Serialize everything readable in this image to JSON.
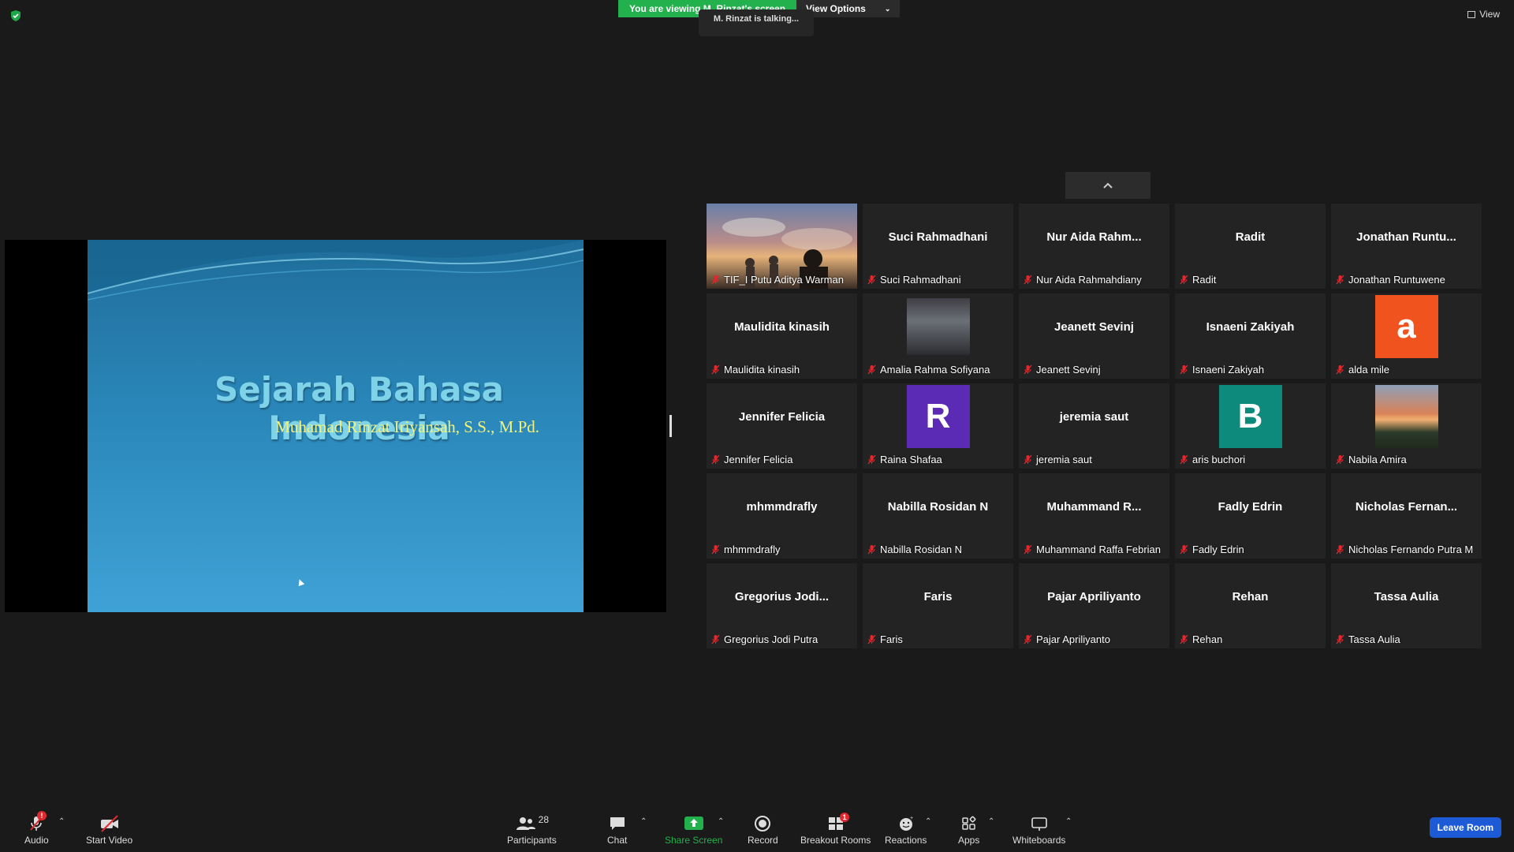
{
  "banner": {
    "viewing_text": "You are viewing M. Rinzat's screen",
    "view_options_label": "View Options",
    "talking_text": "M. Rinzat is talking..."
  },
  "view_button": {
    "label": "View"
  },
  "slide": {
    "title": "Sejarah Bahasa Indonesia",
    "author": "Muhamad Rinzat Iriyansah, S.S., M.Pd."
  },
  "participants_tiles": [
    {
      "center": "",
      "name": "TIF_I Putu Aditya Warman",
      "media": "photo-sky"
    },
    {
      "center": "Suci Rahmadhani",
      "name": "Suci Rahmadhani"
    },
    {
      "center": "Nur Aida Rahm...",
      "name": "Nur Aida Rahmahdiany"
    },
    {
      "center": "Radit",
      "name": "Radit"
    },
    {
      "center": "Jonathan  Runtu...",
      "name": "Jonathan Runtuwene"
    },
    {
      "center": "Maulidita kinasih",
      "name": "Maulidita kinasih"
    },
    {
      "center": "",
      "name": "Amalia Rahma Sofiyana",
      "media": "photo-dark"
    },
    {
      "center": "Jeanett Sevinj",
      "name": "Jeanett Sevinj"
    },
    {
      "center": "Isnaeni Zakiyah",
      "name": "Isnaeni Zakiyah"
    },
    {
      "center": "",
      "name": "alda mile",
      "avatar_letter": "a",
      "avatar_color": "#f0531e"
    },
    {
      "center": "Jennifer Felicia",
      "name": "Jennifer Felicia"
    },
    {
      "center": "",
      "name": "Raina Shafaa",
      "avatar_letter": "R",
      "avatar_color": "#5b2bb5"
    },
    {
      "center": "jeremia saut",
      "name": "jeremia saut"
    },
    {
      "center": "",
      "name": "aris buchori",
      "avatar_letter": "B",
      "avatar_color": "#0d8a7c"
    },
    {
      "center": "",
      "name": "Nabila Amira",
      "media": "photo-sunset"
    },
    {
      "center": "mhmmdrafly",
      "name": "mhmmdrafly"
    },
    {
      "center": "Nabilla Rosidan N",
      "name": "Nabilla Rosidan N"
    },
    {
      "center": "Muhammand  R...",
      "name": "Muhammand Raffa Febrian"
    },
    {
      "center": "Fadly Edrin",
      "name": "Fadly Edrin"
    },
    {
      "center": "Nicholas  Fernan...",
      "name": "Nicholas Fernando Putra M"
    },
    {
      "center": "Gregorius  Jodi...",
      "name": "Gregorius Jodi Putra"
    },
    {
      "center": "Faris",
      "name": "Faris"
    },
    {
      "center": "Pajar Apriliyanto",
      "name": "Pajar Apriliyanto"
    },
    {
      "center": "Rehan",
      "name": "Rehan"
    },
    {
      "center": "Tassa Aulia",
      "name": "Tassa Aulia"
    }
  ],
  "toolbar": {
    "audio_label": "Audio",
    "audio_badge": "!",
    "start_video_label": "Start Video",
    "participants_label": "Participants",
    "participants_count": "28",
    "chat_label": "Chat",
    "share_screen_label": "Share Screen",
    "record_label": "Record",
    "breakout_rooms_label": "Breakout Rooms",
    "breakout_badge": "1",
    "reactions_label": "Reactions",
    "apps_label": "Apps",
    "whiteboards_label": "Whiteboards",
    "leave_label": "Leave Room"
  },
  "colors": {
    "share_green": "#22b14c",
    "leave_blue": "#1d5bd6",
    "mute_red": "#e0282e"
  }
}
